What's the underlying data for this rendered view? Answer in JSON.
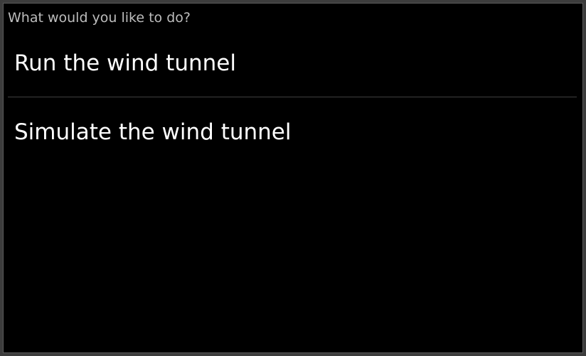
{
  "dialog": {
    "title": "What would you like to do?",
    "options": [
      {
        "label": "Run the wind tunnel"
      },
      {
        "label": "Simulate the wind tunnel"
      }
    ]
  },
  "colors": {
    "background": "#000000",
    "frame_border": "#3d3d3d",
    "title_text": "#bdbdbd",
    "option_text": "#ffffff",
    "divider": "#3f3f3f"
  }
}
